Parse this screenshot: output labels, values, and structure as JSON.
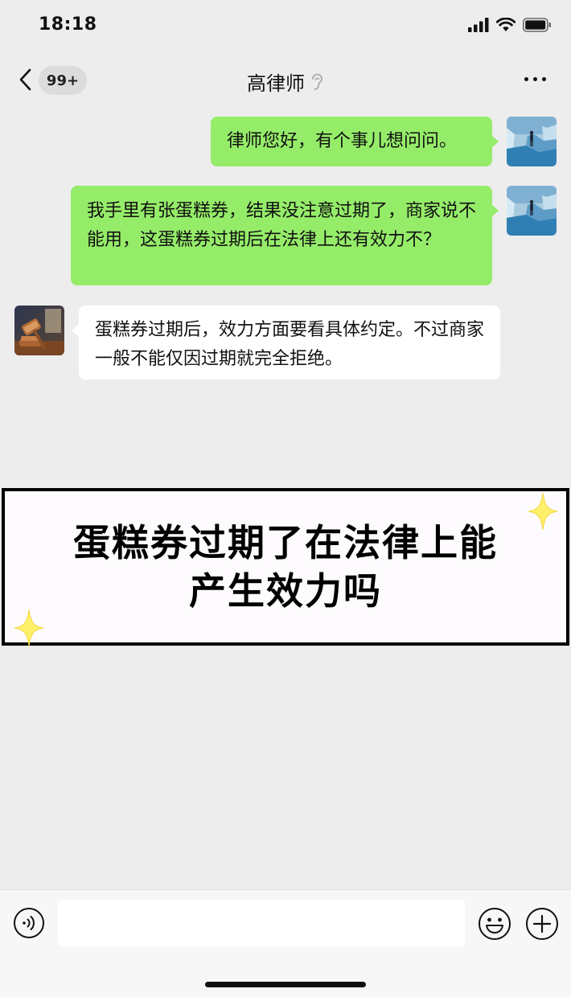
{
  "status_bar": {
    "time": "18:18"
  },
  "nav": {
    "unread_badge": "99+",
    "title": "高律师"
  },
  "messages": [
    {
      "side": "out",
      "text": "律师您好，有个事儿想问问。"
    },
    {
      "side": "out",
      "text": "我手里有张蛋糕券，结果没注意过期了，商家说不能用，这蛋糕券过期后在法律上还有效力不？"
    },
    {
      "side": "in",
      "text": "蛋糕券过期后，效力方面要看具体约定。不过商家一般不能仅因过期就完全拒绝。"
    }
  ],
  "banner": {
    "line1": "蛋糕券过期了在法律上能",
    "line2": "产生效力吗"
  },
  "input": {
    "value": "",
    "placeholder": ""
  },
  "colors": {
    "outgoing_bubble": "#95ec69",
    "incoming_bubble": "#ffffff",
    "background": "#ededed",
    "sparkle": "#fff06a"
  }
}
